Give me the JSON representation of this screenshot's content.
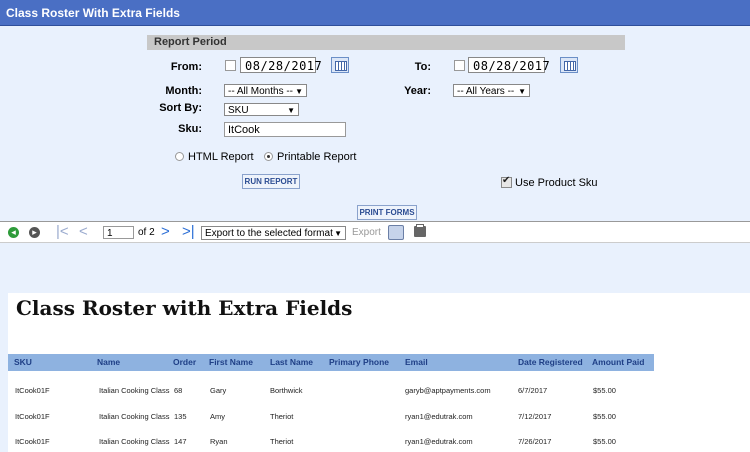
{
  "window": {
    "title": "Class Roster With Extra Fields"
  },
  "form": {
    "section_title": "Report Period",
    "from_label": "From:",
    "from_value": "08/28/2017",
    "to_label": "To:",
    "to_value": "08/28/2017",
    "month_label": "Month:",
    "month_value": "-- All Months --",
    "year_label": "Year:",
    "year_value": "-- All Years --",
    "sortby_label": "Sort By:",
    "sortby_value": "SKU",
    "sku_label": "Sku:",
    "sku_value": "ItCook",
    "html_report_label": "HTML Report",
    "printable_report_label": "Printable Report",
    "selected_format": "Printable Report",
    "run_report_label": "RUN REPORT",
    "use_product_sku_label": "Use Product Sku",
    "use_product_sku_checked": true,
    "print_forms_label": "PRINT FORMS"
  },
  "toolbar": {
    "page_value": "1",
    "of_pages": "of 2",
    "export_format": "Export to the selected format",
    "export_label": "Export"
  },
  "report": {
    "title": "Class Roster with Extra Fields",
    "columns": [
      "SKU",
      "Name",
      "Order",
      "First Name",
      "Last Name",
      "Primary Phone",
      "Email",
      "Date Registered",
      "Amount Paid"
    ],
    "rows": [
      [
        "ItCook01F",
        "Italian Cooking Class",
        "68",
        "Gary",
        "Borthwick",
        "",
        "garyb@aptpayments.com",
        "6/7/2017",
        "$55.00"
      ],
      [
        "ItCook01F",
        "Italian Cooking Class",
        "135",
        "Amy",
        "Theriot",
        "",
        "ryan1@edutrak.com",
        "7/12/2017",
        "$55.00"
      ],
      [
        "ItCook01F",
        "Italian Cooking Class",
        "147",
        "Ryan",
        "Theriot",
        "",
        "ryan1@edutrak.com",
        "7/26/2017",
        "$55.00"
      ]
    ]
  },
  "colors": {
    "titlebar": "#4a6fc4",
    "page_bg": "#e9f1fd",
    "header_row": "#8eb2e0",
    "header_text": "#1f3f86",
    "nav_green": "#2e9b3a"
  }
}
